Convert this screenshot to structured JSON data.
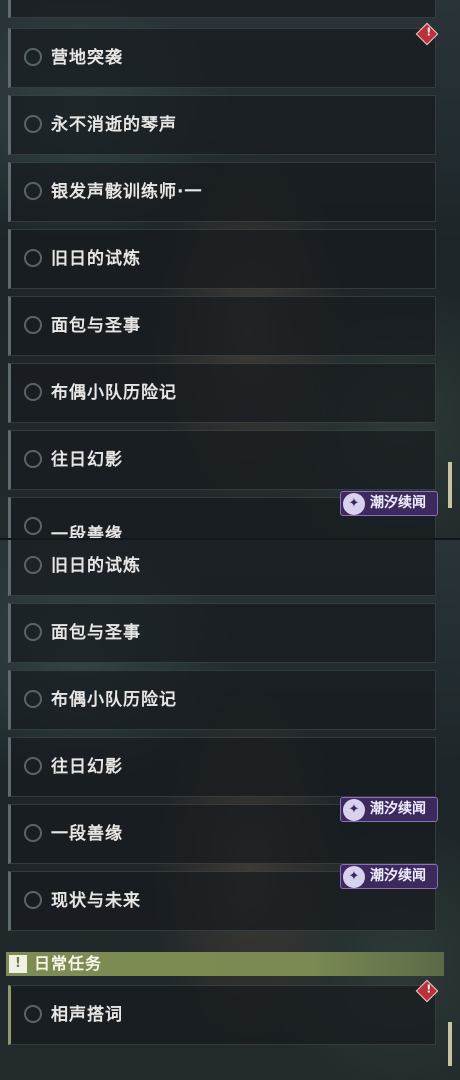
{
  "top_panel": {
    "quests": [
      {
        "label": "",
        "alert": false
      },
      {
        "label": "营地突袭",
        "alert": true
      },
      {
        "label": "永不消逝的琴声",
        "alert": false
      },
      {
        "label": "银发声骸训练师·一",
        "alert": false
      },
      {
        "label": "旧日的试炼",
        "alert": false
      },
      {
        "label": "面包与圣事",
        "alert": false
      },
      {
        "label": "布偶小队历险记",
        "alert": false
      },
      {
        "label": "往日幻影",
        "alert": false
      },
      {
        "label": "一段善缘",
        "alert": false
      }
    ],
    "badge_label": "潮汐续闻"
  },
  "bottom_panel": {
    "quests": [
      {
        "label": "旧日的试炼"
      },
      {
        "label": "面包与圣事"
      },
      {
        "label": "布偶小队历险记"
      },
      {
        "label": "往日幻影"
      },
      {
        "label": "一段善缘",
        "badge": "潮汐续闻"
      },
      {
        "label": "现状与未来",
        "badge": "潮汐续闻"
      }
    ],
    "section": {
      "icon": "!",
      "title": "日常任务"
    },
    "daily_quests": [
      {
        "label": "相声搭词",
        "alert": true
      }
    ]
  },
  "colors": {
    "accent_green": "#7d8c53",
    "badge_purple": "#3c2a5c",
    "alert_red": "#b8323a"
  },
  "icons": {
    "alert": "alert-diamond-icon",
    "badge": "tide-icon",
    "status": "circle-status-icon"
  }
}
